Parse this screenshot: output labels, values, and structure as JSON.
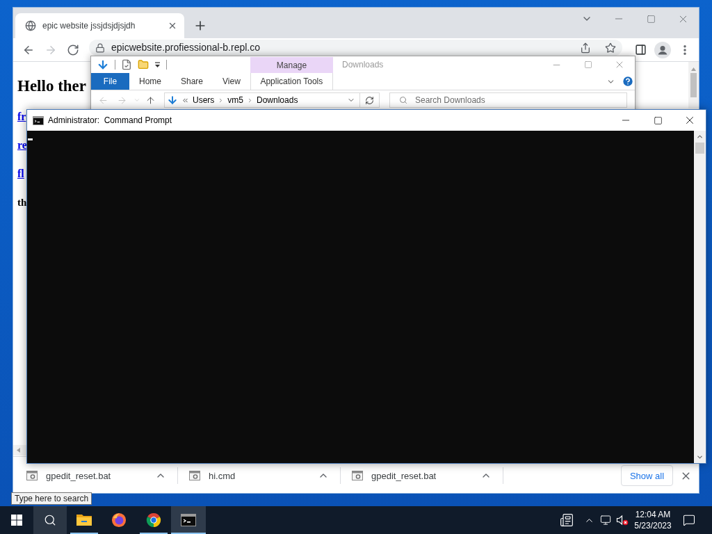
{
  "browser": {
    "tabs": [
      {
        "title": "epic website jssjdsjdjsjdh",
        "selected": true
      }
    ],
    "nav": [
      {
        "kind": "back",
        "disabled": false
      },
      {
        "kind": "forward",
        "disabled": true
      },
      {
        "kind": "reload",
        "disabled": false
      }
    ],
    "address": "epicwebsite.profiessional-b.repl.co",
    "page": {
      "heading": "Hello ther",
      "links": [
        "fr",
        "re",
        "fl"
      ],
      "text": "th"
    },
    "downloads": [
      {
        "name": "gpedit_reset.bat"
      },
      {
        "name": "hi.cmd"
      },
      {
        "name": "gpedit_reset.bat"
      }
    ],
    "show_all": "Show all"
  },
  "explorer": {
    "title": "Downloads",
    "context_header": "Manage",
    "ribbon_tabs": [
      {
        "label": "File",
        "kind": "file"
      },
      {
        "label": "Home",
        "kind": "tab"
      },
      {
        "label": "Share",
        "kind": "tab"
      },
      {
        "label": "View",
        "kind": "tab"
      },
      {
        "label": "Application Tools",
        "kind": "contextual"
      }
    ],
    "nav": [
      {
        "kind": "back",
        "disabled": true
      },
      {
        "kind": "forward",
        "disabled": true
      },
      {
        "kind": "recent",
        "disabled": true
      },
      {
        "kind": "up",
        "disabled": false
      }
    ],
    "breadcrumb": [
      "Users",
      "vm5",
      "Downloads"
    ],
    "search": {
      "placeholder": "Search Downloads"
    }
  },
  "command_prompt": {
    "title": "Administrator:  Command Prompt"
  },
  "search_tooltip": "Type here to search",
  "taskbar": {
    "search": {
      "hovered": true
    },
    "apps": [
      {
        "kind": "explorer",
        "running": true,
        "active": false
      },
      {
        "kind": "firefox",
        "running": false,
        "active": false
      },
      {
        "kind": "chrome",
        "running": true,
        "active": false
      },
      {
        "kind": "terminal",
        "running": true,
        "active": true
      }
    ],
    "tray": {
      "volume_muted": true
    },
    "time": "12:04 AM",
    "date": "5/23/2023"
  }
}
